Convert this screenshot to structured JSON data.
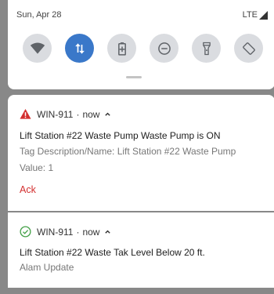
{
  "status_bar": {
    "date": "Sun, Apr 28",
    "network": "LTE"
  },
  "quick_settings": {
    "tiles": [
      {
        "icon": "wifi-icon",
        "active": false
      },
      {
        "icon": "mobile-data-icon",
        "active": true
      },
      {
        "icon": "battery-saver-icon",
        "active": false
      },
      {
        "icon": "do-not-disturb-icon",
        "active": false
      },
      {
        "icon": "flashlight-icon",
        "active": false
      },
      {
        "icon": "auto-rotate-icon",
        "active": false
      }
    ]
  },
  "notifications": [
    {
      "icon": "warning-icon",
      "app": "WIN-911",
      "time": "now",
      "title": "Lift Station #22 Waste Pump Waste Pump is ON",
      "lines": [
        "Tag Description/Name: Lift Station #22 Waste Pump",
        "Value: 1"
      ],
      "action": "Ack"
    },
    {
      "icon": "check-circle-icon",
      "app": "WIN-911",
      "time": "now",
      "title": "Lift Station #22 Waste Tak Level Below 20 ft.",
      "lines": [
        "Alam Update"
      ]
    }
  ],
  "colors": {
    "accent": "#3a78c9",
    "warning": "#d32f2f",
    "success": "#43a047",
    "tile_inactive": "#dadce0"
  }
}
